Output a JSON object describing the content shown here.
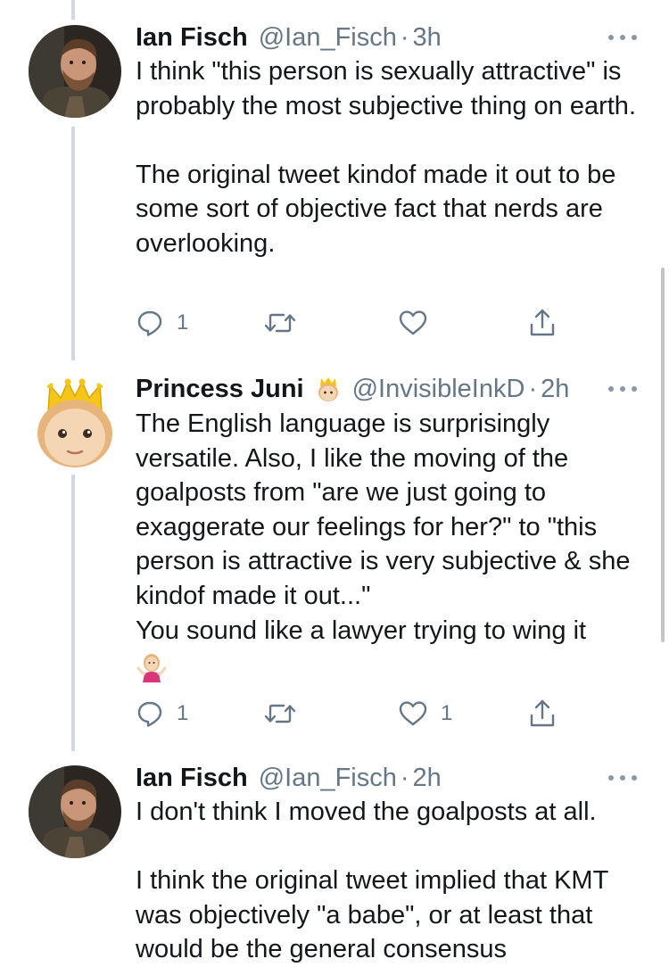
{
  "colors": {
    "text": "#14171a",
    "secondary": "#657786",
    "thread_line": "#cfd9de"
  },
  "tweets": [
    {
      "display_name": "Ian Fisch",
      "handle": "@Ian_Fisch",
      "dot": "·",
      "time": "3h",
      "avatar_icon": "bearded-man-avatar",
      "paragraphs": [
        "I think \"this person is sexually attractive\" is probably the most subjective thing on earth.",
        "",
        "The original tweet kindof made it out to be some sort of objective fact that nerds are overlooking."
      ],
      "reply_count": "1",
      "retweet_count": "",
      "like_count": "",
      "liked": false
    },
    {
      "display_name": "Princess Juni",
      "name_emoji": "princess-emoji",
      "handle": "@InvisibleInkD",
      "dot": "·",
      "time": "2h",
      "avatar_icon": "princess-emoji-avatar",
      "paragraphs": [
        "The English language is surprisingly versatile. Also, I like the moving of the goalposts from \"are we just going to exaggerate our feelings for her?\" to \"this person is attractive is very subjective & she kindof made it out...\"",
        "You sound like a lawyer trying to wing it"
      ],
      "trailing_emoji": "person-shrugging-emoji",
      "reply_count": "1",
      "retweet_count": "",
      "like_count": "1",
      "liked": false
    },
    {
      "display_name": "Ian Fisch",
      "handle": "@Ian_Fisch",
      "dot": "·",
      "time": "2h",
      "avatar_icon": "bearded-man-avatar",
      "paragraphs": [
        "I don't think I moved the goalposts at all.",
        "",
        "I think the original tweet implied that KMT was objectively \"a babe\", or at least that would be the general consensus"
      ]
    }
  ]
}
